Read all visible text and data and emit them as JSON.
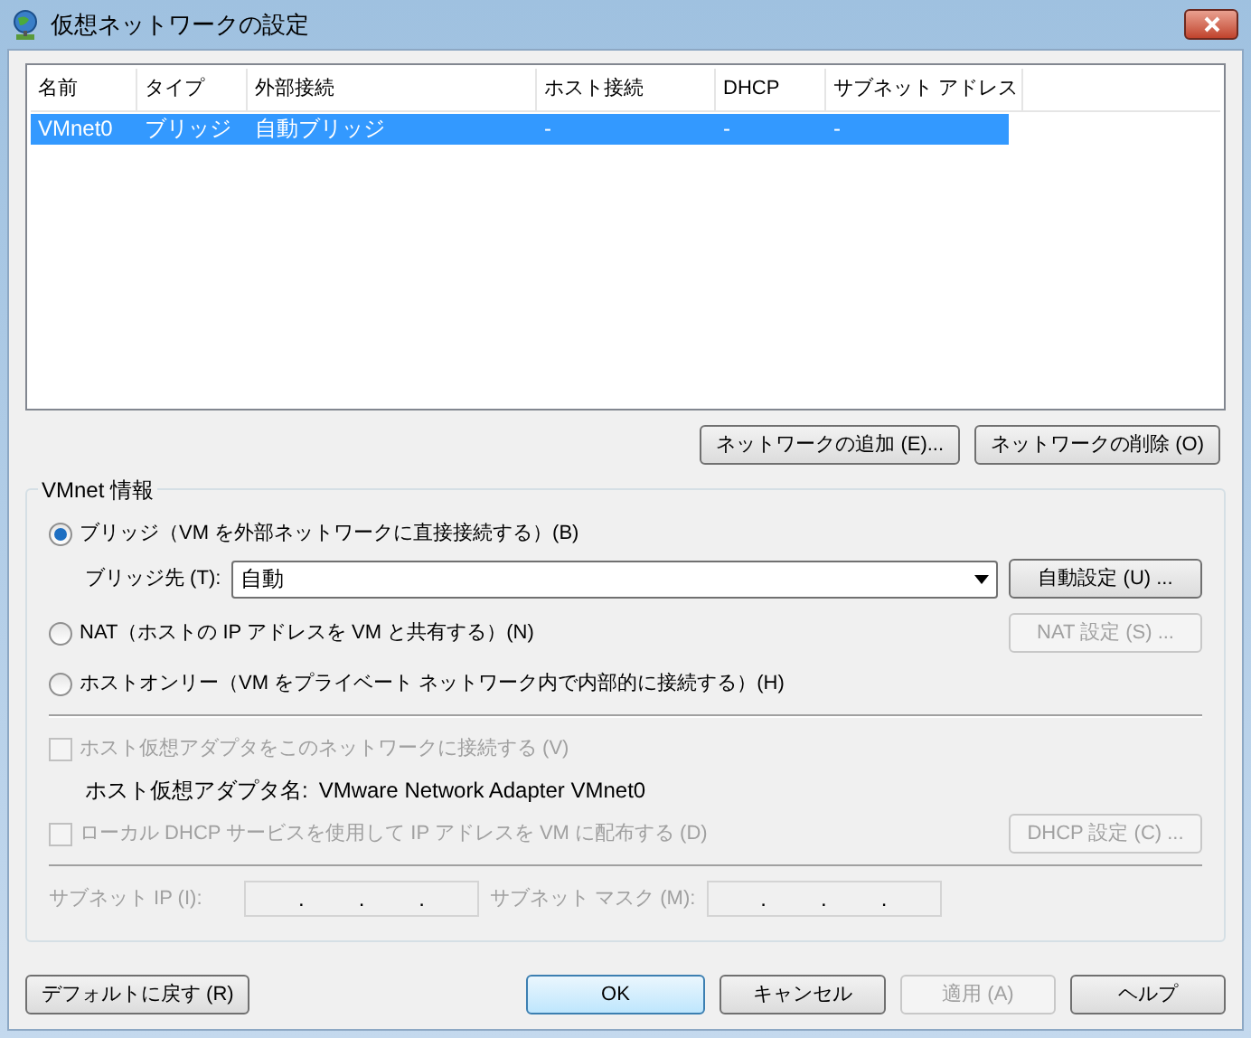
{
  "window": {
    "title": "仮想ネットワークの設定"
  },
  "network_list": {
    "columns": [
      "名前",
      "タイプ",
      "外部接続",
      "ホスト接続",
      "DHCP",
      "サブネット アドレス"
    ],
    "rows": [
      {
        "cells": [
          "VMnet0",
          "ブリッジ",
          "自動ブリッジ",
          "-",
          "-",
          "-"
        ],
        "selected": true
      }
    ]
  },
  "list_buttons": [
    {
      "label": "ネットワークの追加 (E)...",
      "disabled": false
    },
    {
      "label": "ネットワークの削除 (O)",
      "disabled": false
    }
  ],
  "vmnet_info": {
    "title": "VMnet 情報",
    "modes": [
      {
        "label": "ブリッジ（VM を外部ネットワークに直接接続する）(B)",
        "selected": true
      },
      {
        "label": "NAT（ホストの IP アドレスを VM と共有する）(N)",
        "selected": false,
        "button": {
          "label": "NAT 設定 (S) ...",
          "disabled": true
        }
      },
      {
        "label": "ホストオンリー（VM をプライベート ネットワーク内で内部的に接続する）(H)",
        "selected": false
      }
    ],
    "bridge_to": {
      "label": "ブリッジ先 (T):",
      "value": "自動",
      "button": {
        "label": "自動設定 (U) ...",
        "disabled": false
      }
    },
    "host_adapter": {
      "label": "ホスト仮想アダプタをこのネットワークに接続する (V)",
      "checked": false,
      "disabled": true
    },
    "adapter_name": {
      "label": "ホスト仮想アダプタ名:",
      "value": "VMware Network Adapter VMnet0"
    },
    "dhcp": {
      "label": "ローカル DHCP サービスを使用して IP アドレスを VM に配布する (D)",
      "checked": false,
      "disabled": true,
      "button": {
        "label": "DHCP 設定 (C) ...",
        "disabled": true
      }
    },
    "subnet_ip": {
      "label": "サブネット IP (I):",
      "separators": [
        ".",
        ".",
        "."
      ],
      "disabled": true
    },
    "subnet_mask": {
      "label": "サブネット マスク (M):",
      "separators": [
        ".",
        ".",
        "."
      ],
      "disabled": true
    }
  },
  "footer_buttons": [
    {
      "label": "デフォルトに戻す (R)",
      "disabled": false,
      "default": false
    },
    {
      "label": "OK",
      "disabled": false,
      "default": true
    },
    {
      "label": "キャンセル",
      "disabled": false,
      "default": false
    },
    {
      "label": "適用 (A)",
      "disabled": true,
      "default": false
    },
    {
      "label": "ヘルプ",
      "disabled": false,
      "default": false
    }
  ]
}
